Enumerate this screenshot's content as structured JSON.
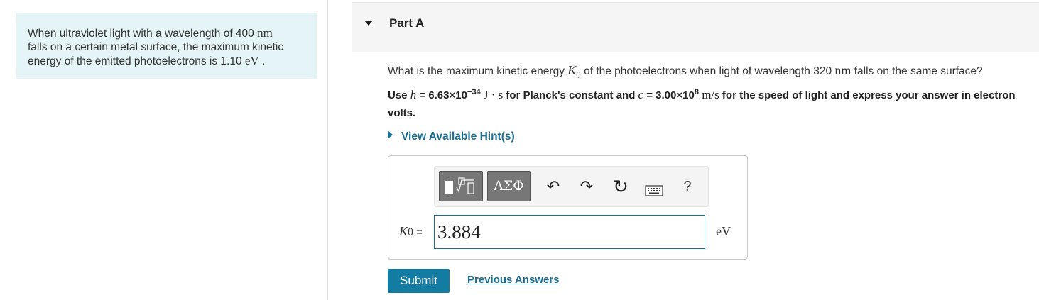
{
  "problem": {
    "line1_text": "When ultraviolet light with a wavelength of 400 ",
    "line1_unit": "nm",
    "line2": "falls on a certain metal surface, the maximum kinetic",
    "line3_text": "energy of the emitted photoelectrons is 1.10 ",
    "line3_unit": "eV",
    "line3_end": " ."
  },
  "part": {
    "title": "Part A"
  },
  "question": {
    "pre": "What is the maximum kinetic energy ",
    "var_symbol": "K",
    "var_sub": "0",
    "mid": " of the photoelectrons when light of wavelength 320 ",
    "unit": "nm",
    "post": " falls on the same surface?"
  },
  "instruction": {
    "use": "Use ",
    "h": "h",
    "h_val": " = 6.63×10",
    "h_exp": "−34",
    "h_unit": " J · s",
    "mid": " for Planck's constant and ",
    "c": "c",
    "c_val": " = 3.00×10",
    "c_exp": "8",
    "c_unit": " m/s",
    "end": " for the speed of light and express your answer in electron volts."
  },
  "hint": {
    "label": "View Available Hint(s)"
  },
  "toolbar": {
    "templates_icon": "templates-icon",
    "greek_label": "ΑΣΦ",
    "undo_glyph": "↶",
    "redo_glyph": "↷",
    "reset_glyph": "↻",
    "keyboard_glyph": "⌨",
    "help_glyph": "?"
  },
  "answer": {
    "var_symbol": "K",
    "var_sub": "0",
    "eq": " =",
    "value": "3.884",
    "unit": "eV"
  },
  "actions": {
    "submit_label": "Submit",
    "previous_answers_label": "Previous Answers"
  },
  "colors": {
    "accent": "#127ca3",
    "link": "#1a6e93",
    "problem_bg": "#e5f5f7"
  }
}
